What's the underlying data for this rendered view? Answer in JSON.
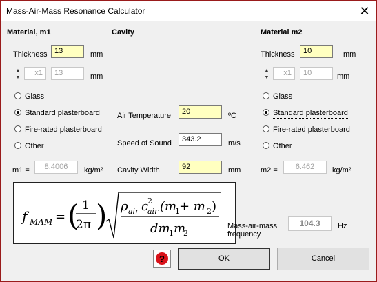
{
  "window": {
    "title": "Mass-Air-Mass Resonance Calculator",
    "close_glyph": "✕"
  },
  "m1": {
    "header": "Material, m1",
    "thickness_label": "Thickness",
    "thickness_value": "13",
    "thickness_unit": "mm",
    "layer_multiplier": "x1",
    "layer_thickness": "13",
    "layer_unit": "mm",
    "options": [
      "Glass",
      "Standard plasterboard",
      "Fire-rated plasterboard",
      "Other"
    ],
    "selected": "Standard plasterboard",
    "mass_label": "m1 =",
    "mass_value": "8.4006",
    "mass_unit": "kg/m²"
  },
  "cavity": {
    "header": "Cavity",
    "air_temp_label": "Air Temperature",
    "air_temp_value": "20",
    "air_temp_unit": "ºC",
    "sound_speed_label": "Speed of Sound",
    "sound_speed_value": "343.2",
    "sound_speed_unit": "m/s",
    "width_label": "Cavity Width",
    "width_value": "92",
    "width_unit": "mm"
  },
  "m2": {
    "header": "Material m2",
    "thickness_label": "Thickness",
    "thickness_value": "10",
    "thickness_unit": "mm",
    "layer_multiplier": "x1",
    "layer_thickness": "10",
    "layer_unit": "mm",
    "options": [
      "Glass",
      "Standard plasterboard",
      "Fire-rated plasterboard",
      "Other"
    ],
    "selected": "Standard plasterboard",
    "mass_label": "m2 =",
    "mass_value": "6.462",
    "mass_unit": "kg/m²"
  },
  "result": {
    "label_line1": "Mass-air-mass",
    "label_line2": "frequency",
    "value": "104.3",
    "unit": "Hz"
  },
  "formula": {
    "lhs": "f",
    "lhs_sub": "MAM",
    "eq": "=",
    "frac_num": "1",
    "frac_den": "2π",
    "rho": "ρ",
    "air": "air",
    "c": "c",
    "sq": "2",
    "paren_expr": "(m",
    "one": "1",
    "plus_m": " + m",
    "two": "2",
    "close": ")",
    "den_d": "dm",
    "den_m": "m"
  },
  "buttons": {
    "ok": "OK",
    "cancel": "Cancel"
  },
  "colors": {
    "input_highlight": "#ffffc0",
    "window_border": "#9a1b1b",
    "help_icon": "#d9131b"
  }
}
